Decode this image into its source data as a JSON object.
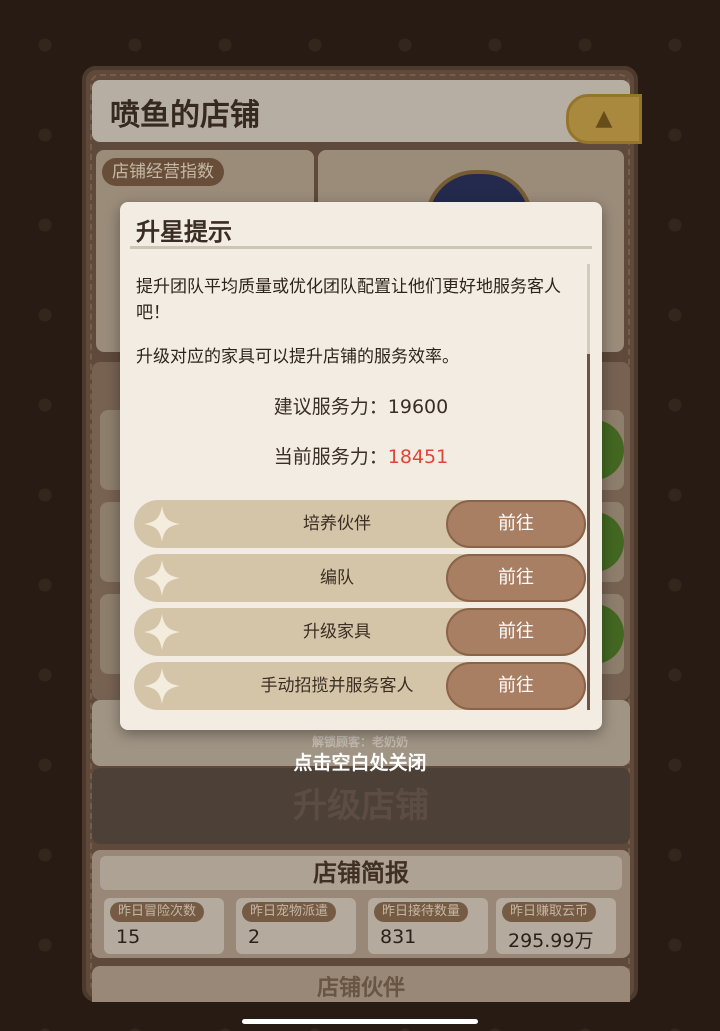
{
  "store": {
    "title": "喷鱼的店铺",
    "stats_chip": "店铺经营指数",
    "unlock_text": "解锁顾客：老奶奶",
    "upgrade_label": "升级店铺",
    "partners_label": "店铺伙伴"
  },
  "report": {
    "title": "店铺简报",
    "cards": [
      {
        "label": "昨日冒险次数",
        "value": "15"
      },
      {
        "label": "昨日宠物派遣",
        "value": "2"
      },
      {
        "label": "昨日接待数量",
        "value": "831"
      },
      {
        "label": "昨日赚取云币",
        "value": "295.99万"
      }
    ]
  },
  "close_hint": "点击空白处关闭",
  "dialog": {
    "title": "升星提示",
    "paragraph1": "提升团队平均质量或优化团队配置让他们更好地服务客人吧！",
    "paragraph2": "升级对应的家具可以提升店铺的服务效率。",
    "suggested_label": "建议服务力：",
    "suggested_value": "19600",
    "current_label": "当前服务力：",
    "current_value": "18451",
    "actions": [
      {
        "label": "培养伙伴",
        "button": "前往"
      },
      {
        "label": "编队",
        "button": "前往"
      },
      {
        "label": "升级家具",
        "button": "前往"
      },
      {
        "label": "手动招揽并服务客人",
        "button": "前往"
      }
    ]
  },
  "colors": {
    "current_value": "#e1453a",
    "button": "#a87f63"
  }
}
